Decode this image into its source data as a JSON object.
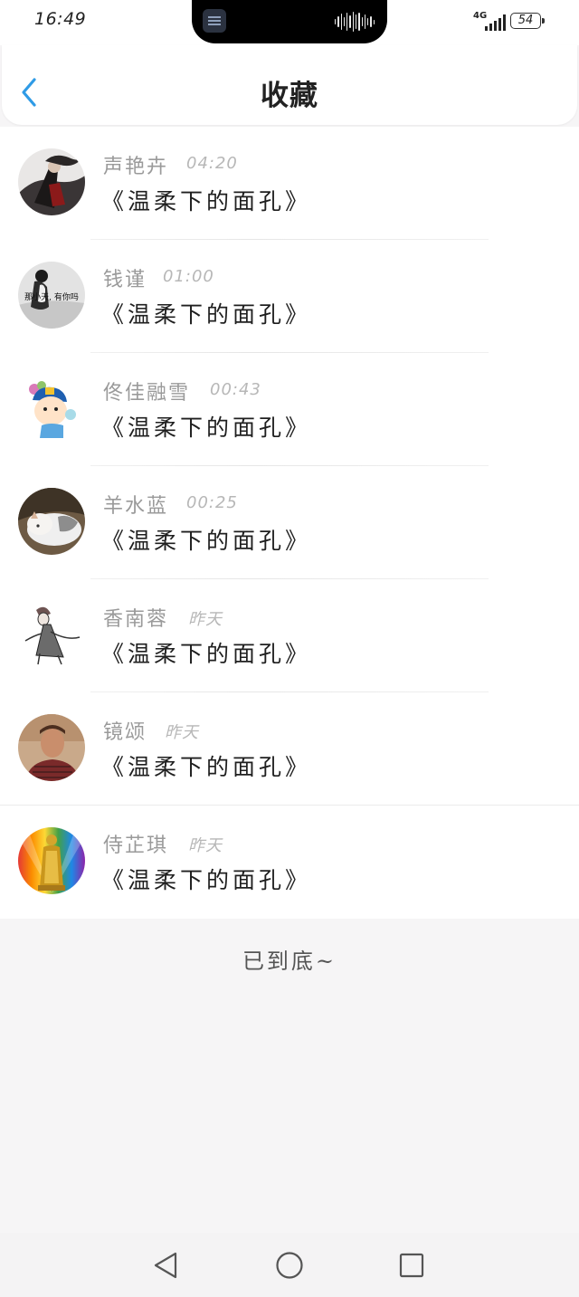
{
  "status_bar": {
    "time": "16:49",
    "network": "4G",
    "battery": "54"
  },
  "header": {
    "title": "收藏",
    "accent_color": "#2f9be6"
  },
  "favorites": [
    {
      "user": "声艳卉",
      "when": "04:20",
      "song": "《温柔下的面孔》",
      "avatar": "ink-swordsman"
    },
    {
      "user": "钱谨",
      "when": "01:00",
      "song": "《温柔下的面孔》",
      "avatar": "girl-caption",
      "avatar_caption": "那小天, 有你吗"
    },
    {
      "user": "佟佳融雪",
      "when": "00:43",
      "song": "《温柔下的面孔》",
      "avatar": "cartoon-child"
    },
    {
      "user": "羊水蓝",
      "when": "00:25",
      "song": "《温柔下的面孔》",
      "avatar": "sleeping-cat"
    },
    {
      "user": "香南蓉",
      "when": "昨天",
      "song": "《温柔下的面孔》",
      "avatar": "gardevoir-sketch"
    },
    {
      "user": "镜颂",
      "when": "昨天",
      "song": "《温柔下的面孔》",
      "avatar": "man-portrait"
    },
    {
      "user": "侍芷琪",
      "when": "昨天",
      "song": "《温柔下的面孔》",
      "avatar": "golden-buddha"
    }
  ],
  "footer": {
    "end_text": "已到底~"
  }
}
